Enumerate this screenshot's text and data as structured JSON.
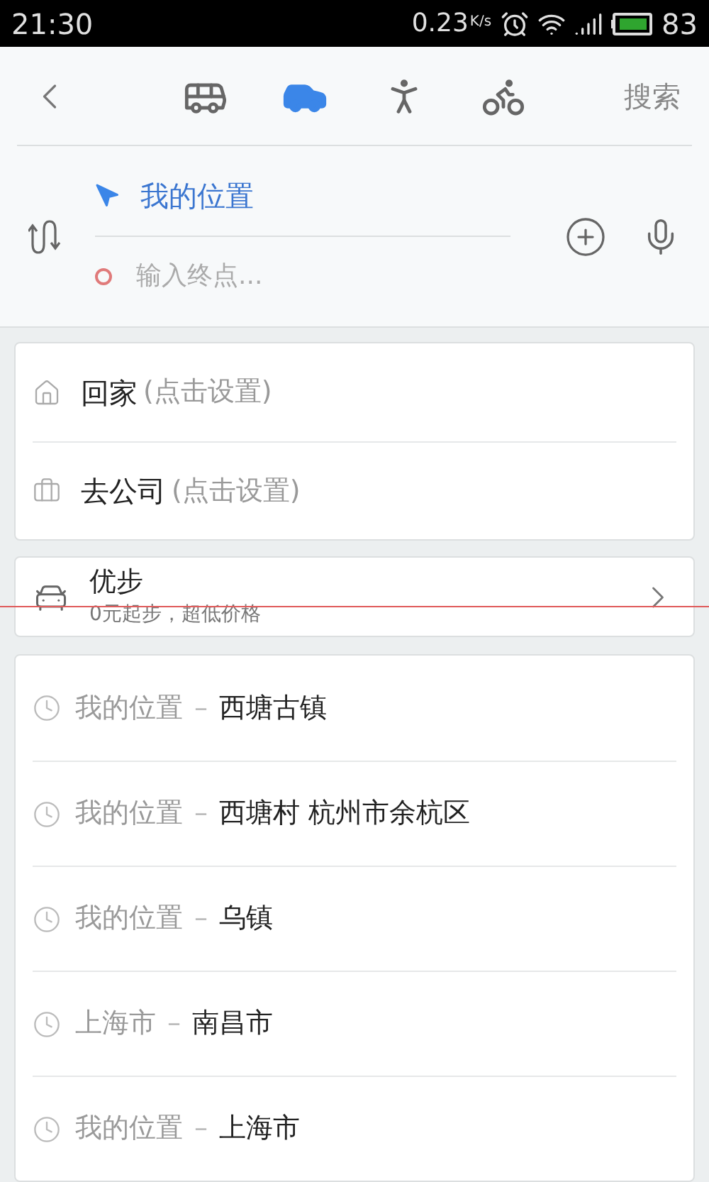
{
  "status_bar": {
    "time": "21:30",
    "speed": "0.23",
    "speed_unit": "K/s",
    "battery": "83"
  },
  "header": {
    "modes": [
      {
        "kind": "bus",
        "selected": false
      },
      {
        "kind": "car",
        "selected": true
      },
      {
        "kind": "walk",
        "selected": false
      },
      {
        "kind": "bike",
        "selected": false
      }
    ],
    "search": "搜索"
  },
  "route": {
    "start": "我的位置",
    "destination_placeholder": "输入终点..."
  },
  "shortcuts": [
    {
      "kind": "home",
      "label": "回家",
      "hint": "(点击设置)"
    },
    {
      "kind": "work",
      "label": "去公司",
      "hint": "(点击设置)"
    }
  ],
  "promo": {
    "title": "优步",
    "subtitle": "0元起步，超低价格"
  },
  "history": [
    {
      "from": "我的位置",
      "separator": "–",
      "to": "西塘古镇"
    },
    {
      "from": "我的位置",
      "separator": "–",
      "to": "西塘村 杭州市余杭区"
    },
    {
      "from": "我的位置",
      "separator": "–",
      "to": "乌镇"
    },
    {
      "from": "上海市",
      "separator": "–",
      "to": "南昌市"
    },
    {
      "from": "我的位置",
      "separator": "–",
      "to": "上海市"
    }
  ]
}
